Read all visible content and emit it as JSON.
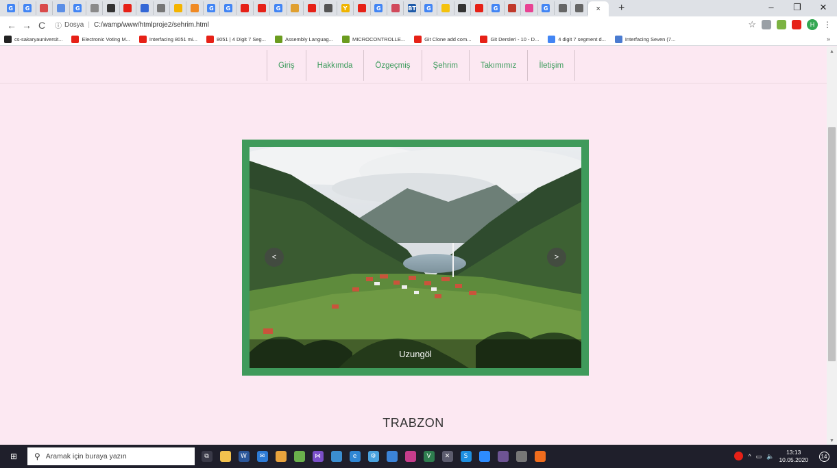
{
  "tabs": [
    {
      "icon": "google-icon",
      "glyph": "G",
      "color": "#4285f4"
    },
    {
      "icon": "google-icon",
      "glyph": "G",
      "color": "#4285f4"
    },
    {
      "icon": "site-icon",
      "glyph": "",
      "color": "#d94a4a"
    },
    {
      "icon": "site-icon",
      "glyph": "",
      "color": "#5b8ee6"
    },
    {
      "icon": "google-icon",
      "glyph": "G",
      "color": "#4285f4"
    },
    {
      "icon": "site-icon",
      "glyph": "",
      "color": "#8a8a8a"
    },
    {
      "icon": "github-icon",
      "glyph": "",
      "color": "#333333"
    },
    {
      "icon": "youtube-icon",
      "glyph": "",
      "color": "#e62117"
    },
    {
      "icon": "site-icon",
      "glyph": "",
      "color": "#3367d6"
    },
    {
      "icon": "site-icon",
      "glyph": "",
      "color": "#777777"
    },
    {
      "icon": "site-icon",
      "glyph": "",
      "color": "#f4b400"
    },
    {
      "icon": "site-icon",
      "glyph": "",
      "color": "#f08a24"
    },
    {
      "icon": "google-icon",
      "glyph": "G",
      "color": "#4285f4"
    },
    {
      "icon": "google-icon",
      "glyph": "G",
      "color": "#4285f4"
    },
    {
      "icon": "youtube-icon",
      "glyph": "",
      "color": "#e62117"
    },
    {
      "icon": "youtube-icon",
      "glyph": "",
      "color": "#e62117"
    },
    {
      "icon": "google-icon",
      "glyph": "G",
      "color": "#4285f4"
    },
    {
      "icon": "site-icon",
      "glyph": "",
      "color": "#e0a030"
    },
    {
      "icon": "youtube-icon",
      "glyph": "",
      "color": "#e62117"
    },
    {
      "icon": "site-icon",
      "glyph": "",
      "color": "#555555"
    },
    {
      "icon": "yahoo-icon",
      "glyph": "Y",
      "color": "#f0b400"
    },
    {
      "icon": "youtube-icon",
      "glyph": "",
      "color": "#e62117"
    },
    {
      "icon": "google-icon",
      "glyph": "G",
      "color": "#4285f4"
    },
    {
      "icon": "site-icon",
      "glyph": "",
      "color": "#d1495b"
    },
    {
      "icon": "site-icon",
      "glyph": "BT",
      "color": "#1e5aa8"
    },
    {
      "icon": "google-icon",
      "glyph": "G",
      "color": "#4285f4"
    },
    {
      "icon": "site-icon",
      "glyph": "",
      "color": "#f4c20d"
    },
    {
      "icon": "github-icon",
      "glyph": "",
      "color": "#333333"
    },
    {
      "icon": "youtube-icon",
      "glyph": "",
      "color": "#e62117"
    },
    {
      "icon": "google-icon",
      "glyph": "G",
      "color": "#4285f4"
    },
    {
      "icon": "site-icon",
      "glyph": "",
      "color": "#c0392b"
    },
    {
      "icon": "site-icon",
      "glyph": "",
      "color": "#e84393"
    },
    {
      "icon": "google-icon",
      "glyph": "G",
      "color": "#4285f4"
    },
    {
      "icon": "site-icon",
      "glyph": "",
      "color": "#666666"
    },
    {
      "icon": "site-icon",
      "glyph": "",
      "color": "#666666"
    }
  ],
  "active_tab": {
    "close": "×"
  },
  "new_tab": "+",
  "window_controls": {
    "minimize": "–",
    "restore": "❐",
    "close": "✕"
  },
  "toolbar": {
    "back": "←",
    "forward": "→",
    "reload": "C",
    "info_icon": "ⓘ",
    "scheme": "Dosya",
    "separator": "|",
    "url": "C:/wamp/www/htmlproje2/sehrim.html",
    "star": "☆",
    "profile_initial": "H",
    "menu": "⋮"
  },
  "extensions": [
    {
      "icon": "extension-icon",
      "color": "#9aa0a6"
    },
    {
      "icon": "extension-icon",
      "color": "#7cb342"
    },
    {
      "icon": "youtube-icon",
      "color": "#e62117"
    }
  ],
  "bookmarks": [
    {
      "label": "cs-sakaryauniversit...",
      "icon": "github-icon",
      "color": "#222222"
    },
    {
      "label": "Electronic Voting M...",
      "icon": "youtube-icon",
      "color": "#e62117"
    },
    {
      "label": "Interfacing 8051 mi...",
      "icon": "youtube-icon",
      "color": "#e62117"
    },
    {
      "label": "8051 | 4 Digit 7 Seg...",
      "icon": "youtube-icon",
      "color": "#e62117"
    },
    {
      "label": "Assembly Languag...",
      "icon": "uc-icon",
      "color": "#6b9c1f"
    },
    {
      "label": "MICROCONTROLLE...",
      "icon": "uc-icon",
      "color": "#6b9c1f"
    },
    {
      "label": "Git Clone add com...",
      "icon": "youtube-icon",
      "color": "#e62117"
    },
    {
      "label": "Git Dersleri - 10 - D...",
      "icon": "youtube-icon",
      "color": "#e62117"
    },
    {
      "label": "4 digit 7 segment d...",
      "icon": "google-icon",
      "color": "#4285f4"
    },
    {
      "label": "Interfacing Seven (7...",
      "icon": "diamond-icon",
      "color": "#4a7bd0"
    }
  ],
  "bookmarks_more": "»",
  "menu": [
    {
      "label": "Giriş"
    },
    {
      "label": "Hakkımda"
    },
    {
      "label": "Özgeçmiş"
    },
    {
      "label": "Şehrim"
    },
    {
      "label": "Takımımız"
    },
    {
      "label": "İletişim"
    }
  ],
  "slider": {
    "caption": "Uzungöl",
    "prev": "<",
    "next": ">",
    "frame_color": "#3f9a5b"
  },
  "page_title": "TRABZON",
  "scrollbar": {
    "up": "▲",
    "down": "▼"
  },
  "taskbar": {
    "start": "⊞",
    "search_icon": "⚲",
    "search_placeholder": "Aramak için buraya yazın",
    "apps": [
      {
        "icon": "task-view-icon",
        "color": "#3a3a48",
        "glyph": "⧉"
      },
      {
        "icon": "file-explorer-icon",
        "color": "#f2c14e",
        "glyph": ""
      },
      {
        "icon": "word-icon",
        "color": "#2b579a",
        "glyph": "W"
      },
      {
        "icon": "mail-icon",
        "color": "#2d7bd6",
        "glyph": "✉"
      },
      {
        "icon": "chrome-icon",
        "color": "#e8a33d",
        "glyph": ""
      },
      {
        "icon": "notepadpp-icon",
        "color": "#6ab04c",
        "glyph": ""
      },
      {
        "icon": "visual-studio-icon",
        "color": "#7a4fc9",
        "glyph": "⋈"
      },
      {
        "icon": "proteus-icon",
        "color": "#3b8ed1",
        "glyph": ""
      },
      {
        "icon": "edge-icon",
        "color": "#2f86d3",
        "glyph": "e"
      },
      {
        "icon": "settings-icon",
        "color": "#4aa3df",
        "glyph": "⚙"
      },
      {
        "icon": "app-icon",
        "color": "#3b83d8",
        "glyph": ""
      },
      {
        "icon": "intellij-icon",
        "color": "#c63d8c",
        "glyph": ""
      },
      {
        "icon": "keil-icon",
        "color": "#2e7d4f",
        "glyph": "V"
      },
      {
        "icon": "xming-icon",
        "color": "#5c5c6e",
        "glyph": "✕"
      },
      {
        "icon": "skype-icon",
        "color": "#1e8fe0",
        "glyph": "S"
      },
      {
        "icon": "zoom-icon",
        "color": "#2d8cff",
        "glyph": ""
      },
      {
        "icon": "github-desktop-icon",
        "color": "#6e5494",
        "glyph": ""
      },
      {
        "icon": "app-icon",
        "color": "#777777",
        "glyph": ""
      },
      {
        "icon": "firefox-icon",
        "color": "#f06c1d",
        "glyph": ""
      }
    ],
    "tray": {
      "badge_color": "#e62117",
      "chevron": "^",
      "battery": "▭",
      "volume": "🔈",
      "time": "13:13",
      "date": "10.05.2020",
      "notif_count": "14"
    }
  }
}
